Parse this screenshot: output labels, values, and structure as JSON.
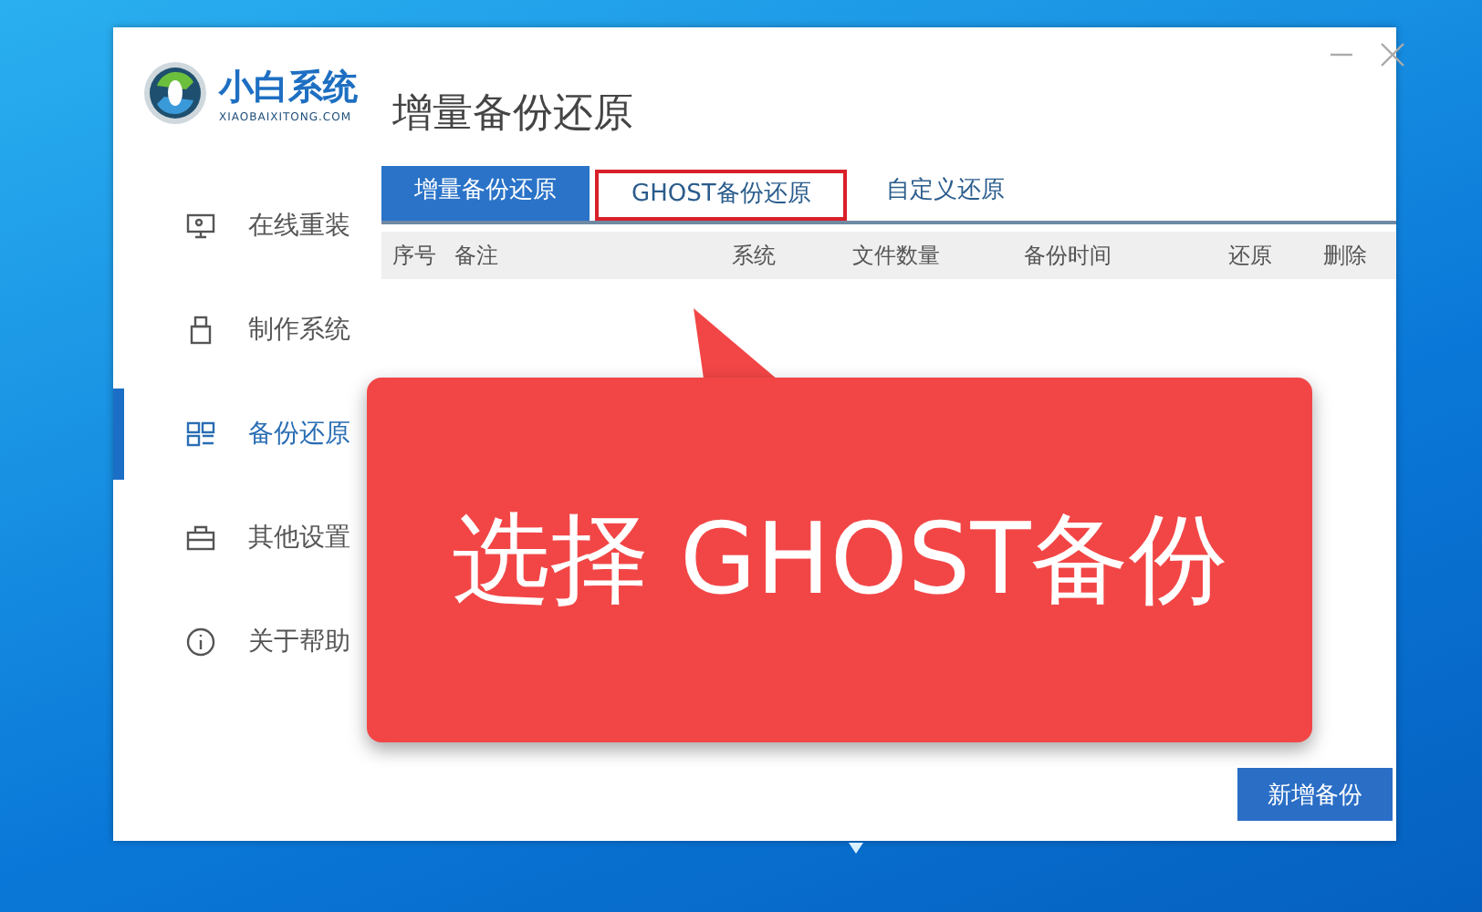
{
  "logo": {
    "name": "小白系统",
    "site": "XIAOBAIXITONG.COM"
  },
  "sidebar": {
    "items": [
      {
        "label": "在线重装",
        "selected": false
      },
      {
        "label": "制作系统",
        "selected": false
      },
      {
        "label": "备份还原",
        "selected": true
      },
      {
        "label": "其他设置",
        "selected": false
      },
      {
        "label": "关于帮助",
        "selected": false
      }
    ]
  },
  "page_title": "增量备份还原",
  "tabs": [
    {
      "label": "增量备份还原",
      "selected": true,
      "highlighted": false
    },
    {
      "label": "GHOST备份还原",
      "selected": false,
      "highlighted": true
    },
    {
      "label": "自定义还原",
      "selected": false,
      "highlighted": false
    }
  ],
  "table": {
    "columns": [
      "序号",
      "备注",
      "系统",
      "文件数量",
      "备份时间",
      "还原",
      "删除"
    ]
  },
  "callout": {
    "text": "选择 GHOST备份"
  },
  "buttons": [
    "新增备份"
  ]
}
